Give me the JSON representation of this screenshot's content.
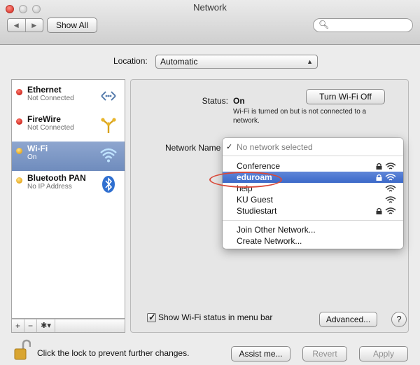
{
  "window": {
    "title": "Network"
  },
  "toolbar": {
    "show_all": "Show All",
    "back": "◀",
    "forward": "▶"
  },
  "location": {
    "label": "Location:",
    "value": "Automatic"
  },
  "sidebar": {
    "items": [
      {
        "name": "Ethernet",
        "status": "Not Connected",
        "dot": "#d0281e",
        "icon": "ethernet-icon"
      },
      {
        "name": "FireWire",
        "status": "Not Connected",
        "dot": "#d0281e",
        "icon": "firewire-icon"
      },
      {
        "name": "Wi-Fi",
        "status": "On",
        "dot": "#e5a417",
        "icon": "wifi-icon",
        "selected": true
      },
      {
        "name": "Bluetooth PAN",
        "status": "No IP Address",
        "dot": "#e5a417",
        "icon": "bluetooth-icon"
      }
    ],
    "tools": {
      "add": "+",
      "remove": "−",
      "gear": "✱▾"
    }
  },
  "status": {
    "label": "Status:",
    "value": "On",
    "button": "Turn Wi-Fi Off",
    "description": "Wi-Fi is turned on but is not connected to a network."
  },
  "network_name": {
    "label": "Network Name",
    "menu": {
      "current": "No network selected",
      "networks": [
        {
          "name": "Conference",
          "locked": true
        },
        {
          "name": "eduroam",
          "locked": true,
          "highlighted": true
        },
        {
          "name": "help",
          "locked": false
        },
        {
          "name": "KU Guest",
          "locked": false
        },
        {
          "name": "Studiestart",
          "locked": true
        }
      ],
      "join_other": "Join Other Network...",
      "create": "Create Network..."
    }
  },
  "show_wifi_status": {
    "label": "Show Wi-Fi status in menu bar",
    "checked": true
  },
  "buttons": {
    "advanced": "Advanced...",
    "help": "?",
    "assist": "Assist me...",
    "revert": "Revert",
    "apply": "Apply"
  },
  "footer": {
    "lock_text": "Click the lock to prevent further changes."
  },
  "colors": {
    "highlight": "#3c69c9",
    "annotation_ellipse": "#d94a3a",
    "selected_row": "#7b96c4"
  }
}
